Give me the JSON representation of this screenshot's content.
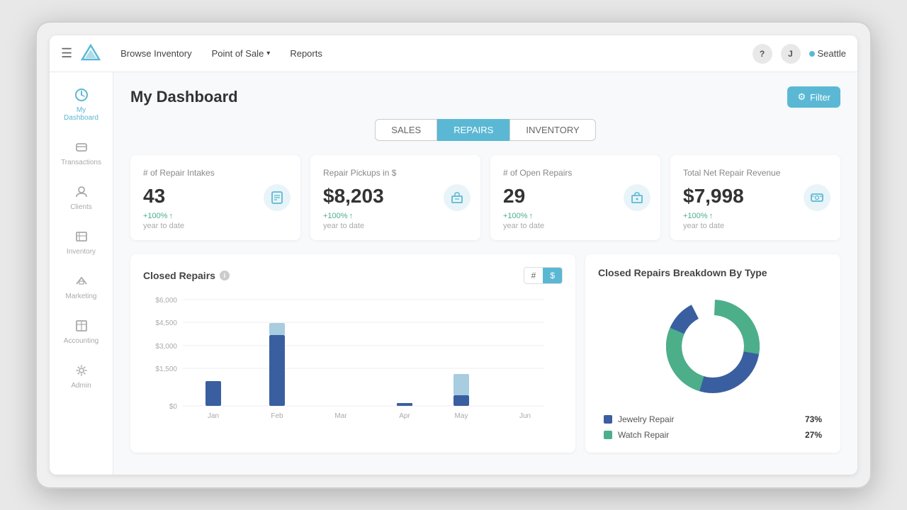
{
  "nav": {
    "hamburger": "☰",
    "items": [
      {
        "label": "Browse Inventory",
        "id": "browse-inventory"
      },
      {
        "label": "Point of Sale",
        "id": "point-of-sale",
        "hasDropdown": true
      },
      {
        "label": "Reports",
        "id": "reports"
      }
    ],
    "right": {
      "help": "?",
      "user": "J",
      "location_label": "Seattle"
    }
  },
  "sidebar": {
    "items": [
      {
        "label": "My Dashboard",
        "id": "dashboard",
        "icon": "dashboard",
        "active": true
      },
      {
        "label": "Transactions",
        "id": "transactions",
        "icon": "transactions"
      },
      {
        "label": "Clients",
        "id": "clients",
        "icon": "clients"
      },
      {
        "label": "Inventory",
        "id": "inventory",
        "icon": "inventory"
      },
      {
        "label": "Marketing",
        "id": "marketing",
        "icon": "marketing"
      },
      {
        "label": "Accounting",
        "id": "accounting",
        "icon": "accounting"
      },
      {
        "label": "Admin",
        "id": "admin",
        "icon": "admin"
      }
    ]
  },
  "header": {
    "title": "My Dashboard",
    "filter_label": "Filter"
  },
  "tabs": [
    {
      "label": "SALES",
      "id": "sales",
      "active": false
    },
    {
      "label": "REPAIRS",
      "id": "repairs",
      "active": true
    },
    {
      "label": "INVENTORY",
      "id": "inventory",
      "active": false
    }
  ],
  "kpis": [
    {
      "title": "# of Repair Intakes",
      "value": "43",
      "change": "+100%",
      "period": "year to date",
      "icon": "📋"
    },
    {
      "title": "Repair Pickups in $",
      "value": "$8,203",
      "change": "+100%",
      "period": "year to date",
      "icon": "📦"
    },
    {
      "title": "# of Open Repairs",
      "value": "29",
      "change": "+100%",
      "period": "year to date",
      "icon": "🔧"
    },
    {
      "title": "Total Net Repair Revenue",
      "value": "$7,998",
      "change": "+100%",
      "period": "year to date",
      "icon": "💳"
    }
  ],
  "bar_chart": {
    "title": "Closed Repairs",
    "toggle": {
      "hash": "#",
      "dollar": "$",
      "active": "dollar"
    },
    "y_labels": [
      "$6,000",
      "$4,500",
      "$3,000",
      "$1,500",
      "$0"
    ],
    "x_labels": [
      "Jan",
      "Feb",
      "Mar",
      "Apr",
      "May",
      "Jun"
    ],
    "bars": [
      {
        "month": "Jan",
        "dark": 1400,
        "light": 0
      },
      {
        "month": "Feb",
        "dark": 4000,
        "light": 4700
      },
      {
        "month": "Mar",
        "dark": 0,
        "light": 0
      },
      {
        "month": "Apr",
        "dark": 150,
        "light": 0
      },
      {
        "month": "May",
        "dark": 600,
        "light": 1800
      },
      {
        "month": "Jun",
        "dark": 0,
        "light": 0
      }
    ],
    "max": 6000
  },
  "donut_chart": {
    "title": "Closed Repairs Breakdown By Type",
    "segments": [
      {
        "label": "Jewelry Repair",
        "pct": 73,
        "color": "#3a5fa0"
      },
      {
        "label": "Watch Repair",
        "pct": 27,
        "color": "#4caf8a"
      }
    ]
  }
}
